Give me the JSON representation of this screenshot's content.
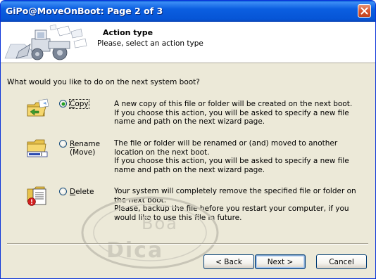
{
  "window": {
    "title": "GiPo@MoveOnBoot: Page 2 of 3"
  },
  "header": {
    "title": "Action type",
    "subtitle": "Please, select an action type"
  },
  "question": "What would you like to do on the next system boot?",
  "options": [
    {
      "label": "Copy",
      "underline": "C",
      "rest": "opy",
      "checked": true,
      "icon": "copy-folder-icon",
      "lines": [
        "A new copy of this file or folder will be created on the next boot.",
        "If you choose this action, you will be asked to specify a new file name and path on the next wizard page."
      ]
    },
    {
      "label": "Rename (Move)",
      "underline": "R",
      "rest": "ename",
      "rest2": "(Move)",
      "checked": false,
      "icon": "rename-folder-icon",
      "lines": [
        "The file or folder will be renamed or (and) moved to another location on the next boot.",
        "If you choose this action, you will be asked to specify a new file name and path on the next wizard page."
      ]
    },
    {
      "label": "Delete",
      "underline": "D",
      "rest": "elete",
      "checked": false,
      "icon": "delete-file-icon",
      "lines": [
        "Your system will completely remove the specified file or folder on the next boot.",
        "Please, backup the file before you restart your computer, if you would like to use this file in future."
      ]
    }
  ],
  "watermark": {
    "line1": "Boa",
    "line2": "Dica"
  },
  "buttons": {
    "back": "< Back",
    "next": "Next >",
    "cancel": "Cancel"
  },
  "colors": {
    "titlebar": "#0a5fd8",
    "dialog_bg": "#ece9d8",
    "radio_dot": "#21a121",
    "close_button": "#d6552f"
  }
}
